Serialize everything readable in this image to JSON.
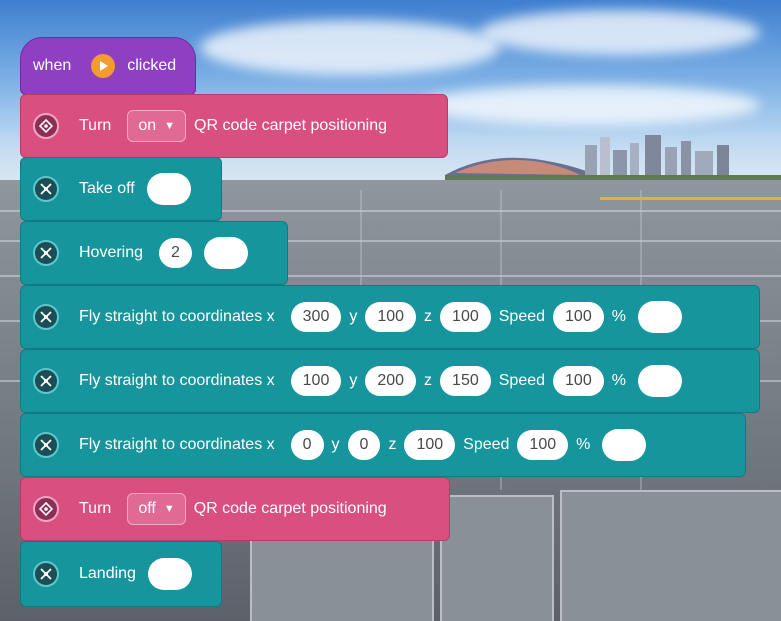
{
  "hat_block": {
    "word1": "when",
    "icon": "play-icon",
    "word2": "clicked"
  },
  "blocks": [
    {
      "kind": "turn",
      "label_turn": "Turn",
      "state": "on",
      "label_tail": "QR code carpet positioning"
    },
    {
      "kind": "takeoff",
      "label": "Take off"
    },
    {
      "kind": "hover",
      "label": "Hovering",
      "value": "2"
    },
    {
      "kind": "fly",
      "label": "Fly straight to coordinates x",
      "x": "300",
      "y_label": "y",
      "y": "100",
      "z_label": "z",
      "z": "100",
      "speed_label": "Speed",
      "speed": "100",
      "pct": "%"
    },
    {
      "kind": "fly",
      "label": "Fly straight to coordinates x",
      "x": "100",
      "y_label": "y",
      "y": "200",
      "z_label": "z",
      "z": "150",
      "speed_label": "Speed",
      "speed": "100",
      "pct": "%"
    },
    {
      "kind": "fly",
      "label": "Fly straight to coordinates x",
      "x": "0",
      "y_label": "y",
      "y": "0",
      "z_label": "z",
      "z": "100",
      "speed_label": "Speed",
      "speed": "100",
      "pct": "%"
    },
    {
      "kind": "turn",
      "label_turn": "Turn",
      "state": "off",
      "label_tail": "QR code carpet positioning"
    },
    {
      "kind": "landing",
      "label": "Landing"
    }
  ],
  "colors": {
    "hat": "#8e3fc2",
    "pink": "#d84f80",
    "teal": "#17959d",
    "play": "#f29b2e"
  }
}
